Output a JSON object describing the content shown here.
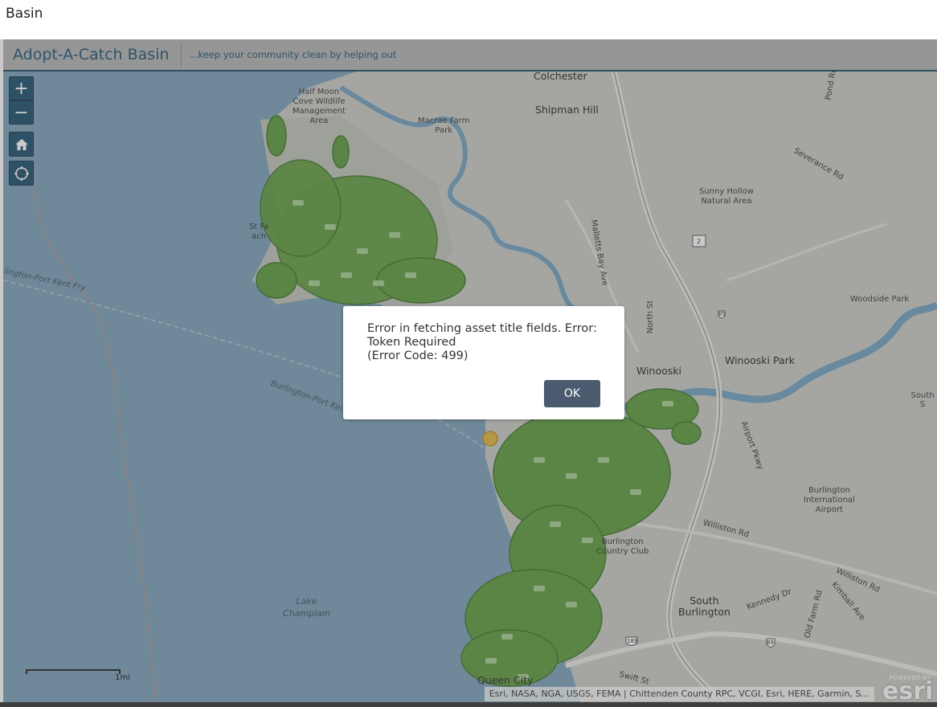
{
  "page": {
    "title": "Basin"
  },
  "header": {
    "title": "Adopt-A-Catch Basin",
    "subtitle": "...keep your community clean by helping out"
  },
  "map_controls": {
    "zoom_in_label": "+",
    "zoom_out_label": "−",
    "home_icon": "home-icon",
    "locate_icon": "locate-icon"
  },
  "dialog": {
    "message": "Error in fetching asset title fields. Error:\nToken Required\n(Error Code: 499)",
    "ok_label": "OK"
  },
  "scalebar": {
    "label": "1mi"
  },
  "attribution": "Esri, NASA, NGA, USGS, FEMA | Chittenden County RPC, VCGI, Esri, HERE, Garmin, S...",
  "esri_logo": {
    "powered_by": "POWERED BY",
    "brand": "esri"
  },
  "map_labels": {
    "colchester": "Colchester",
    "shipman_hill": "Shipman Hill",
    "half_moon": "Half Moon\nCove Wildlife\nManagement\nArea",
    "macrae": "Macrae Farm\nPark",
    "sunny_hollow": "Sunny Hollow\nNatural Area",
    "severance": "Severance Rd",
    "pond": "Pond Rd",
    "malletts": "Malletts Bay Ave",
    "north_st": "North St",
    "woodside": "Woodside Park",
    "winooski": "Winooski",
    "winooski_park": "Winooski Park",
    "south_s": "South S",
    "airport_pkwy": "Airport Pkwy",
    "burlington_airport": "Burlington\nInternational\nAirport",
    "williston_rd": "Williston Rd",
    "williston_rd2": "Williston Rd",
    "kennedy": "Kennedy Dr",
    "kimball": "Kimball Ave",
    "old_farm": "Old Farm Rd",
    "south_burlington": "South\nBurlington",
    "burlington_cc": "Burlington\nCountry Club",
    "queen_city": "Queen City",
    "swift_st": "Swift St",
    "lake_champlain": "Lake\nChamplain",
    "ferry1": "lington-Port Kent Fry",
    "ferry2": "Burlington-Port Kent",
    "stave": "St  Fa\nach",
    "rt2": "2",
    "rt89a": "89",
    "rt89b": "89",
    "rt189": "189"
  },
  "colors": {
    "water": "#7aa0b8",
    "land": "#c9cbc4",
    "header_bg": "#b3b3b3",
    "brand_blue": "#1a4f70",
    "marker_green": "#5c9a3c",
    "marker_highlight": "#e0b43a",
    "ok_button": "#4b5a6e"
  }
}
